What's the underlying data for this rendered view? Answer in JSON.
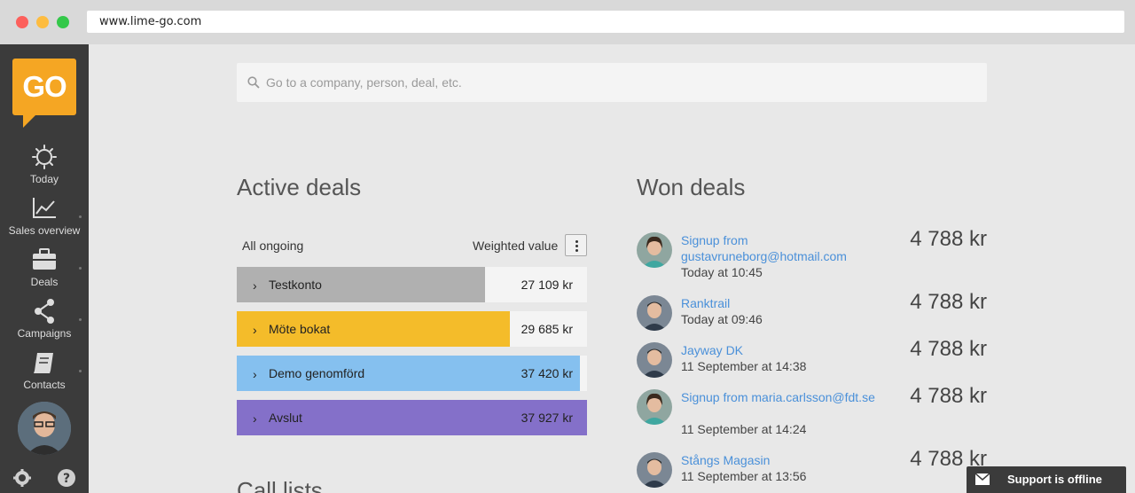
{
  "browser": {
    "url": "www.lime-go.com"
  },
  "sidebar": {
    "logo": "GO",
    "items": [
      {
        "label": "Today",
        "icon": "gear-icon"
      },
      {
        "label": "Sales overview",
        "icon": "chart-icon"
      },
      {
        "label": "Deals",
        "icon": "briefcase-icon"
      },
      {
        "label": "Campaigns",
        "icon": "share-icon"
      },
      {
        "label": "Contacts",
        "icon": "book-icon"
      }
    ]
  },
  "search": {
    "placeholder": "Go to a company, person, deal, etc.",
    "value": ""
  },
  "active_deals": {
    "title": "Active deals",
    "filter_label": "All ongoing",
    "value_label": "Weighted value",
    "rows": [
      {
        "name": "Testkonto",
        "value": "27 109 kr",
        "color": "#b0b0b0",
        "fill_percent": 71
      },
      {
        "name": "Möte bokat",
        "value": "29 685 kr",
        "color": "#f4bc2a",
        "fill_percent": 78
      },
      {
        "name": "Demo genomförd",
        "value": "37 420 kr",
        "color": "#85c0ef",
        "fill_percent": 98
      },
      {
        "name": "Avslut",
        "value": "37 927 kr",
        "color": "#8470c9",
        "fill_percent": 100
      }
    ]
  },
  "call_lists": {
    "title": "Call lists"
  },
  "won_deals": {
    "title": "Won deals",
    "items": [
      {
        "title": "Signup from gustavruneborg@hotmail.com",
        "date": "Today at 10:45",
        "amount": "4 788 kr",
        "avatar": "woman"
      },
      {
        "title": "Ranktrail",
        "date": "Today at 09:46",
        "amount": "4 788 kr",
        "avatar": "man"
      },
      {
        "title": "Jayway DK",
        "date": "11 September at 14:38",
        "amount": "4 788 kr",
        "avatar": "man"
      },
      {
        "title": "Signup from maria.carlsson@fdt.se",
        "date": "11 September at 14:24",
        "amount": "4 788 kr",
        "avatar": "woman"
      },
      {
        "title": "Stångs Magasin",
        "date": "11 September at 13:56",
        "amount": "4 788 kr",
        "avatar": "man"
      }
    ]
  },
  "support": {
    "label": "Support is offline"
  }
}
